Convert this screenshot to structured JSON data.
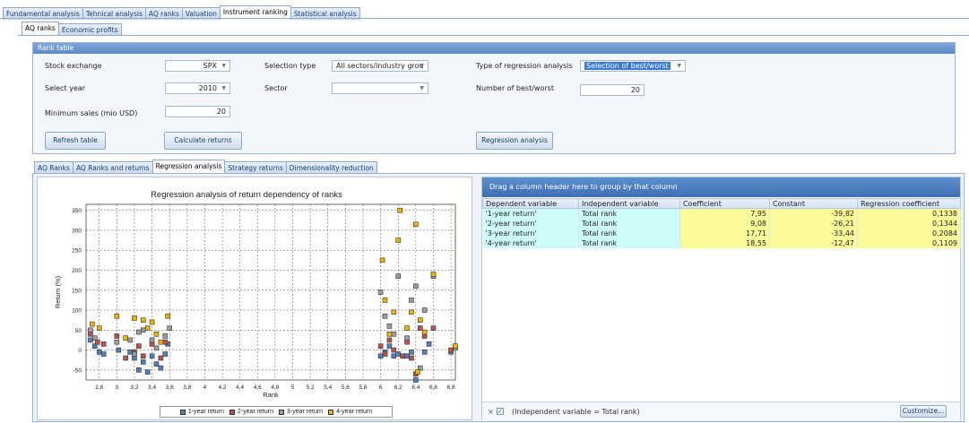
{
  "top_tabs": [
    "Fundamental analysis",
    "Tehnical analysis",
    "AQ ranks",
    "Valuation",
    "Instrument ranking",
    "Statistical analysis"
  ],
  "sub_tabs": [
    "AQ ranks",
    "Economic profits"
  ],
  "rank_table": {
    "title": "Rank table",
    "stock_exchange_label": "Stock exchange",
    "stock_exchange_value": "SPX",
    "select_year_label": "Select year",
    "select_year_value": "2010",
    "min_sales_label": "Minimum sales (mio USD)",
    "min_sales_value": "20",
    "selection_type_label": "Selection type",
    "selection_type_value": "All sectors/industry grou",
    "sector_label": "Sector",
    "sector_value": "",
    "regression_type_label": "Type of regression analysis",
    "regression_type_value": "Selection of best/worst",
    "best_worst_label": "Number of best/worst",
    "best_worst_value": "20",
    "refresh_button": "Refresh table",
    "calc_button": "Calculate returns",
    "regression_button": "Regression analysis"
  },
  "analysis_tabs": [
    "AQ Ranks",
    "AQ Ranks and returns",
    "Regression analysis",
    "Strategy returns",
    "Dimensionality reduction"
  ],
  "grid": {
    "group_hint": "Drag a column header here to group by that column",
    "columns": [
      "Dependent variable",
      "Independent variable",
      "Coefficient",
      "Constant",
      "Regression coefficient"
    ],
    "rows": [
      [
        "'1-year return'",
        "Total rank",
        "7,95",
        "-39,82",
        "0,1338"
      ],
      [
        "'2-year return'",
        "Total rank",
        "9,08",
        "-26,21",
        "0,1344"
      ],
      [
        "'3-year return'",
        "Total rank",
        "17,71",
        "-33,44",
        "0,2084"
      ],
      [
        "'4-year return'",
        "Total rank",
        "18,55",
        "-12,47",
        "0,1109"
      ]
    ],
    "filter_text": "(Independent variable = Total rank)",
    "customize_button": "Customize..."
  },
  "chart_data": {
    "type": "scatter",
    "title": "Regression analysis of return dependency of ranks",
    "xlabel": "Rank",
    "ylabel": "Return (%)",
    "xlim": [
      2.65,
      6.85
    ],
    "ylim": [
      -75,
      365
    ],
    "x_ticks": [
      "2,8",
      "3",
      "3,2",
      "3,4",
      "3,6",
      "3,8",
      "4",
      "4,2",
      "4,4",
      "4,6",
      "4,8",
      "5",
      "5,2",
      "5,4",
      "5,6",
      "5,8",
      "6",
      "6,2",
      "6,4",
      "6,6",
      "6,8"
    ],
    "y_ticks": [
      "350",
      "300",
      "250",
      "200",
      "150",
      "100",
      "50",
      "0",
      "-50"
    ],
    "grid": true,
    "legend_position": "bottom",
    "series": [
      {
        "name": "1-year return",
        "color": "#4f81bd",
        "points": [
          [
            2.7,
            25
          ],
          [
            2.75,
            10
          ],
          [
            2.8,
            -5
          ],
          [
            2.85,
            -10
          ],
          [
            3.02,
            0
          ],
          [
            3.15,
            -5
          ],
          [
            3.2,
            -20
          ],
          [
            3.25,
            -50
          ],
          [
            3.3,
            -30
          ],
          [
            3.35,
            -55
          ],
          [
            3.4,
            -15
          ],
          [
            3.45,
            -35
          ],
          [
            3.5,
            -45
          ],
          [
            3.55,
            -10
          ],
          [
            3.58,
            15
          ],
          [
            6.0,
            -15
          ],
          [
            6.05,
            -5
          ],
          [
            6.1,
            10
          ],
          [
            6.15,
            -15
          ],
          [
            6.2,
            -10
          ],
          [
            6.3,
            -15
          ],
          [
            6.35,
            -5
          ],
          [
            6.4,
            -75
          ],
          [
            6.5,
            -5
          ],
          [
            6.55,
            15
          ],
          [
            6.8,
            -5
          ]
        ]
      },
      {
        "name": "2-year return",
        "color": "#c0504d",
        "points": [
          [
            2.7,
            40
          ],
          [
            2.78,
            20
          ],
          [
            2.85,
            15
          ],
          [
            3.0,
            35
          ],
          [
            3.1,
            -20
          ],
          [
            3.2,
            -5
          ],
          [
            3.25,
            10
          ],
          [
            3.3,
            -15
          ],
          [
            3.4,
            15
          ],
          [
            3.5,
            -20
          ],
          [
            3.55,
            20
          ],
          [
            6.0,
            10
          ],
          [
            6.05,
            -10
          ],
          [
            6.1,
            25
          ],
          [
            6.15,
            0
          ],
          [
            6.25,
            -15
          ],
          [
            6.3,
            20
          ],
          [
            6.35,
            -20
          ],
          [
            6.4,
            -60
          ],
          [
            6.45,
            55
          ],
          [
            6.5,
            35
          ],
          [
            6.6,
            55
          ],
          [
            6.8,
            0
          ]
        ]
      },
      {
        "name": "3-year return",
        "color": "#9c9c9c",
        "points": [
          [
            2.7,
            50
          ],
          [
            2.75,
            30
          ],
          [
            3.0,
            20
          ],
          [
            3.15,
            25
          ],
          [
            3.2,
            -10
          ],
          [
            3.25,
            45
          ],
          [
            3.3,
            50
          ],
          [
            3.4,
            25
          ],
          [
            3.45,
            5
          ],
          [
            3.55,
            35
          ],
          [
            3.6,
            55
          ],
          [
            6.0,
            145
          ],
          [
            6.05,
            85
          ],
          [
            6.1,
            60
          ],
          [
            6.15,
            40
          ],
          [
            6.2,
            185
          ],
          [
            6.3,
            30
          ],
          [
            6.35,
            125
          ],
          [
            6.4,
            160
          ],
          [
            6.45,
            -45
          ],
          [
            6.5,
            100
          ],
          [
            6.6,
            185
          ],
          [
            6.85,
            5
          ]
        ]
      },
      {
        "name": "4-year return",
        "color": "#f0b400",
        "points": [
          [
            2.72,
            65
          ],
          [
            2.8,
            55
          ],
          [
            3.0,
            85
          ],
          [
            3.1,
            30
          ],
          [
            3.2,
            80
          ],
          [
            3.3,
            75
          ],
          [
            3.35,
            55
          ],
          [
            3.4,
            70
          ],
          [
            3.45,
            40
          ],
          [
            3.5,
            20
          ],
          [
            3.58,
            85
          ],
          [
            6.02,
            225
          ],
          [
            6.05,
            125
          ],
          [
            6.1,
            40
          ],
          [
            6.15,
            95
          ],
          [
            6.2,
            275
          ],
          [
            6.22,
            350
          ],
          [
            6.3,
            55
          ],
          [
            6.35,
            95
          ],
          [
            6.4,
            315
          ],
          [
            6.42,
            -55
          ],
          [
            6.45,
            75
          ],
          [
            6.5,
            45
          ],
          [
            6.6,
            190
          ],
          [
            6.85,
            10
          ]
        ]
      }
    ]
  }
}
